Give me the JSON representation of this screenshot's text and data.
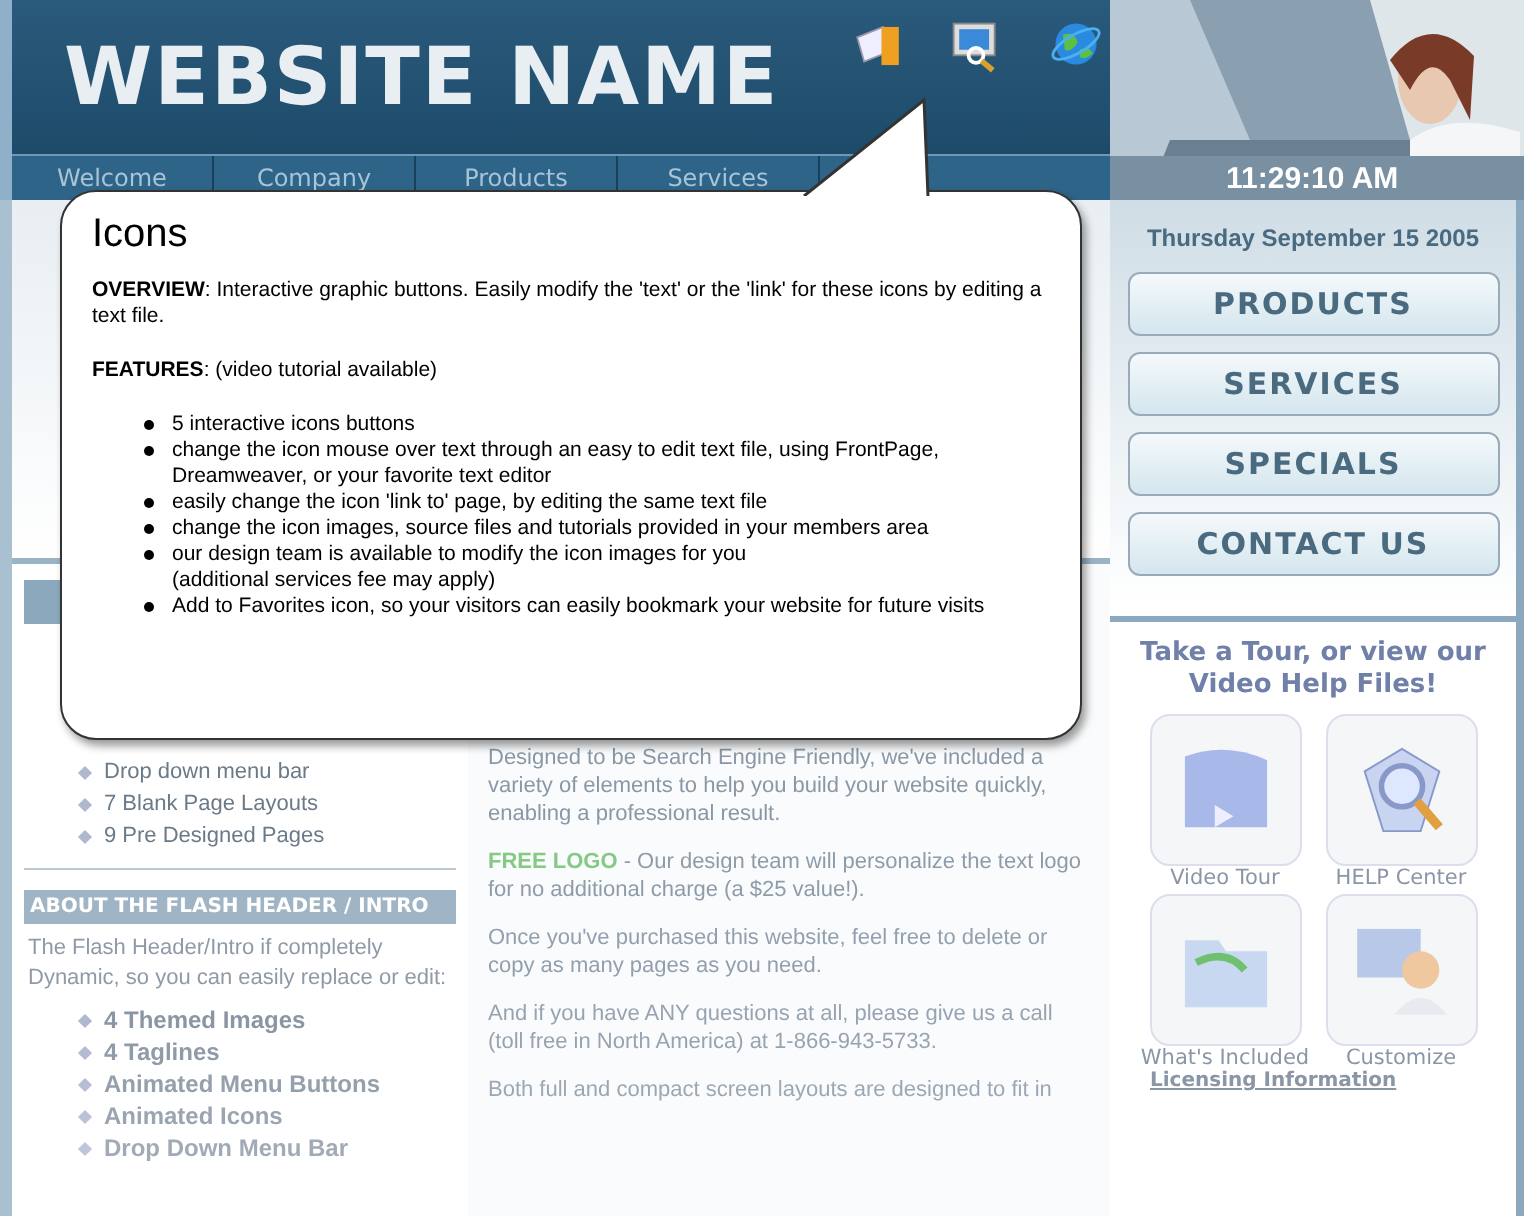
{
  "header": {
    "logo": "WEBSITE NAME",
    "clock": "11:29:10 AM",
    "nav": [
      "Welcome",
      "Company",
      "Products",
      "Services"
    ]
  },
  "sidebar": {
    "date": "Thursday September 15 2005",
    "buttons": [
      "PRODUCTS",
      "SERVICES",
      "SPECIALS",
      "CONTACT US"
    ],
    "tour_title": "Take a Tour, or view our Video Help Files!",
    "tiles": [
      {
        "kind": "video",
        "label": "Video Tour"
      },
      {
        "kind": "help",
        "label": "HELP Center"
      },
      {
        "kind": "folder",
        "label": "What's Included"
      },
      {
        "kind": "person",
        "label": "Customize"
      }
    ],
    "link": "Licensing Information"
  },
  "features": {
    "items": [
      "Drop down menu bar",
      "7 Blank Page Layouts",
      "9 Pre Designed Pages"
    ]
  },
  "flash": {
    "title": "ABOUT THE FLASH HEADER / INTRO",
    "text": "The Flash Header/Intro if completely Dynamic, so you can easily replace or edit:",
    "items": [
      "4 Themed Images",
      "4 Taglines",
      "Animated Menu Buttons",
      "Animated Icons",
      "Drop Down Menu Bar"
    ]
  },
  "main": {
    "paragraphs": [
      "Designed to be Search Engine Friendly, we've included a variety of elements to help you build your website quickly, enabling a professional result.",
      "**FREE LOGO** - Our design team will personalize the text logo for no additional charge (a $25 value!).",
      "Once you've purchased this website, feel free to delete or copy as many pages as you need.",
      "And if you have ANY questions at all, please give us a call (toll free in North America) at 1-866-943-5733.",
      "Both full and compact screen layouts are designed to fit in"
    ]
  },
  "popup": {
    "title": "Icons",
    "overview_label": "OVERVIEW",
    "overview": ": Interactive graphic buttons. Easily modify the 'text' or the 'link' for these icons by editing a text file.",
    "features_label": "FEATURES",
    "features": ": (video tutorial available)",
    "bullets": [
      "5 interactive icons buttons",
      "change the icon mouse over text through an easy to edit text file, using FrontPage, Dreamweaver, or your favorite text editor",
      "easily change the icon 'link to' page, by editing the same text file",
      "change the icon images, source files and tutorials provided in your members area",
      "our design team is available to modify the icon images for you\n(additional services fee may apply)",
      "Add to Favorites icon, so your visitors can easily bookmark your website for future visits"
    ]
  }
}
